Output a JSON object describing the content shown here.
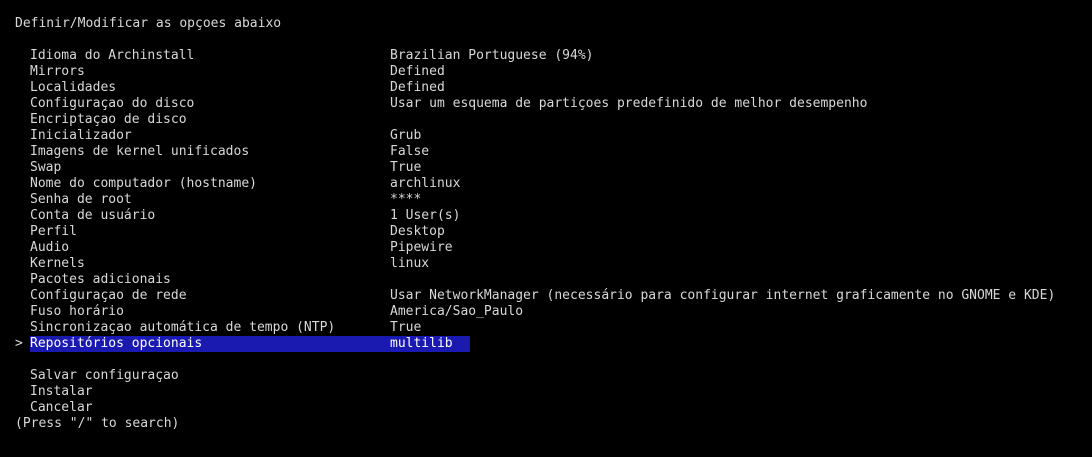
{
  "header": {
    "title": "Definir/Modificar as opçoes abaixo"
  },
  "cursor_symbol": ">",
  "selected_color": "#1a1ab0",
  "menu": {
    "items": [
      {
        "label": "Idioma do Archinstall",
        "value": "Brazilian Portuguese (94%)"
      },
      {
        "label": "Mirrors",
        "value": "Defined"
      },
      {
        "label": "Localidades",
        "value": "Defined"
      },
      {
        "label": "Configuraçao do disco",
        "value": "Usar um esquema de partiçoes predefinido de melhor desempenho"
      },
      {
        "label": "Encriptaçao de disco",
        "value": ""
      },
      {
        "label": "Inicializador",
        "value": "Grub"
      },
      {
        "label": "Imagens de kernel unificados",
        "value": "False"
      },
      {
        "label": "Swap",
        "value": "True"
      },
      {
        "label": "Nome do computador (hostname)",
        "value": "archlinux"
      },
      {
        "label": "Senha de root",
        "value": "****"
      },
      {
        "label": "Conta de usuário",
        "value": "1 User(s)"
      },
      {
        "label": "Perfil",
        "value": "Desktop"
      },
      {
        "label": "Audio",
        "value": "Pipewire"
      },
      {
        "label": "Kernels",
        "value": "linux"
      },
      {
        "label": "Pacotes adicionais",
        "value": ""
      },
      {
        "label": "Configuraçao de rede",
        "value": "Usar NetworkManager (necessário para configurar internet graficamente no GNOME e KDE)"
      },
      {
        "label": "Fuso horário",
        "value": "America/Sao_Paulo"
      },
      {
        "label": "Sincronizaçao automática de tempo (NTP)",
        "value": "True"
      },
      {
        "label": "Repositórios opcionais",
        "value": "multilib"
      }
    ],
    "actions": [
      {
        "label": "Salvar configuraçao"
      },
      {
        "label": "Instalar"
      },
      {
        "label": "Cancelar"
      }
    ]
  },
  "footer": {
    "hint": "(Press \"/\" to search)"
  }
}
